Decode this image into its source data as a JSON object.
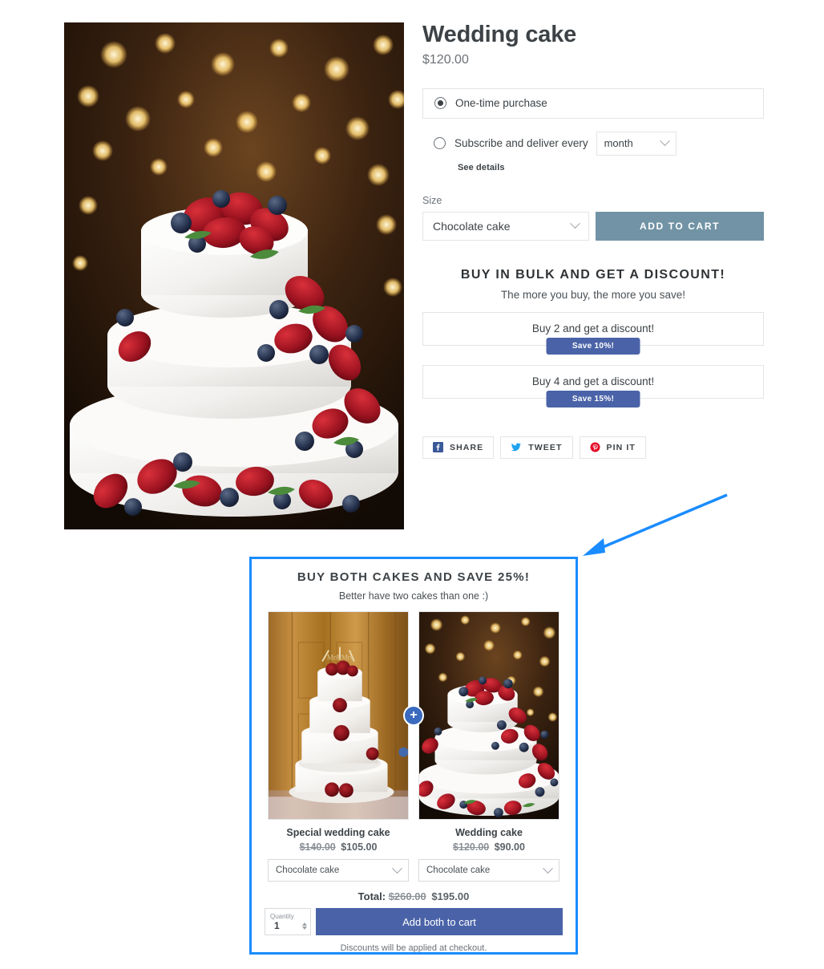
{
  "product": {
    "title": "Wedding cake",
    "price": "$120.00",
    "image_alt": "berry-wedding-cake-photo"
  },
  "purchase_options": {
    "one_time": {
      "label": "One-time purchase",
      "selected": true
    },
    "subscribe": {
      "label": "Subscribe and deliver every",
      "selected": false,
      "interval_value": "month",
      "see_details_label": "See details"
    }
  },
  "variant": {
    "label": "Size",
    "selected": "Chocolate cake"
  },
  "add_to_cart_label": "ADD TO CART",
  "bulk": {
    "title": "BUY IN BULK AND GET A DISCOUNT!",
    "subtitle": "The more you buy, the more you save!",
    "tiers": [
      {
        "label": "Buy 2 and get a discount!",
        "badge": "Save 10%!"
      },
      {
        "label": "Buy 4 and get a discount!",
        "badge": "Save 15%!"
      }
    ]
  },
  "social": [
    {
      "label": "SHARE",
      "icon": "facebook-icon",
      "color": "#3b5998"
    },
    {
      "label": "TWEET",
      "icon": "twitter-icon",
      "color": "#1da1f2"
    },
    {
      "label": "PIN IT",
      "icon": "pinterest-icon",
      "color": "#e60023"
    }
  ],
  "bundle": {
    "title": "BUY BOTH CAKES AND SAVE 25%!",
    "subtitle": "Better have two cakes than one :)",
    "plus_symbol": "+",
    "items": [
      {
        "name": "Special wedding cake",
        "price_old": "$140.00",
        "price_new": "$105.00",
        "variant": "Chocolate cake",
        "image_alt": "rose-wedding-cake-photo"
      },
      {
        "name": "Wedding cake",
        "price_old": "$120.00",
        "price_new": "$90.00",
        "variant": "Chocolate cake",
        "image_alt": "berry-wedding-cake-photo"
      }
    ],
    "total_label": "Total:",
    "total_old": "$260.00",
    "total_new": "$195.00",
    "quantity_label": "Quantity",
    "quantity_value": "1",
    "add_both_label": "Add both to cart",
    "note": "Discounts will be applied at checkout."
  },
  "annotation": {
    "arrow_color": "#1a8cff",
    "highlight_color": "#1a8cff"
  },
  "colors": {
    "add_to_cart_bg": "#7193a5",
    "badge_bg": "#4a63a8",
    "bundle_button_bg": "#4a63a8",
    "plus_badge_bg": "#3b6bbf"
  }
}
